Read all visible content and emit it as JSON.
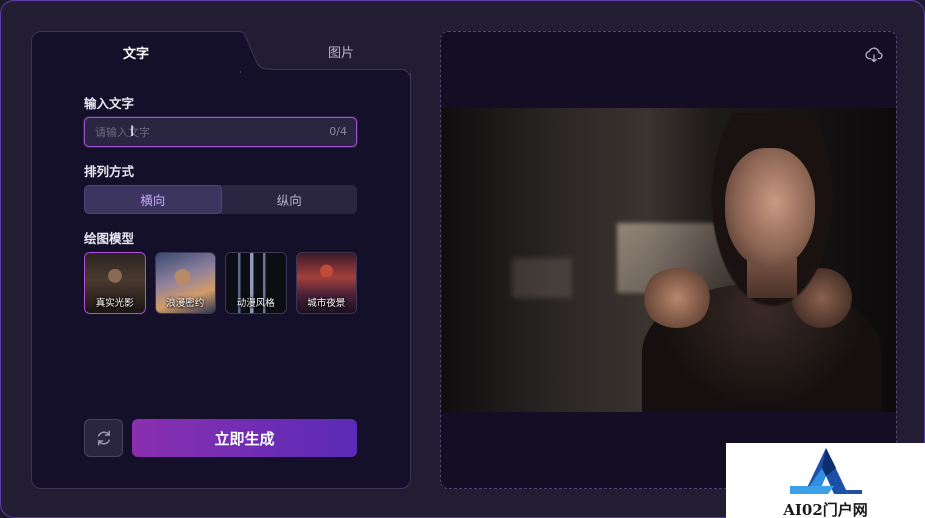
{
  "tabs": [
    {
      "label": "文字",
      "active": true
    },
    {
      "label": "图片",
      "active": false
    }
  ],
  "text_input": {
    "label": "输入文字",
    "placeholder": "请输入文字",
    "value": "",
    "counter": "0/4"
  },
  "layout": {
    "label": "排列方式",
    "options": [
      {
        "label": "横向",
        "active": true
      },
      {
        "label": "纵向",
        "active": false
      }
    ]
  },
  "model": {
    "label": "绘图模型",
    "items": [
      {
        "label": "真实光影",
        "selected": true
      },
      {
        "label": "浪漫密约",
        "selected": false
      },
      {
        "label": "动漫风格",
        "selected": false
      },
      {
        "label": "城市夜景",
        "selected": false
      }
    ]
  },
  "actions": {
    "refresh_icon": "refresh-icon",
    "generate_label": "立即生成"
  },
  "preview": {
    "download_icon": "cloud-download-icon"
  },
  "watermark": {
    "text": "AI02门户网"
  },
  "colors": {
    "accent": "#a04fd0",
    "generate_gradient_start": "#8a2fae",
    "generate_gradient_end": "#5a2bb8",
    "background": "#221d33",
    "panel": "#15102a"
  }
}
